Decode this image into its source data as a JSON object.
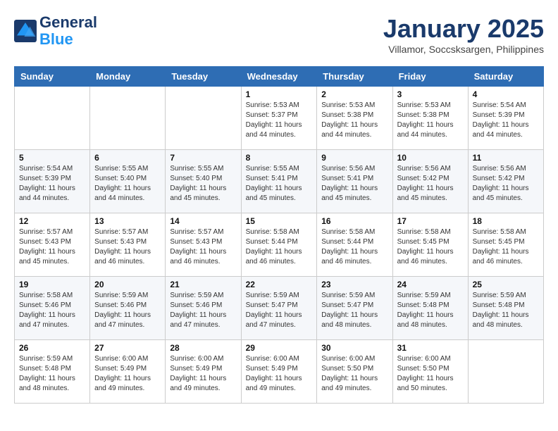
{
  "header": {
    "logo_line1": "General",
    "logo_line2": "Blue",
    "month_title": "January 2025",
    "location": "Villamor, Soccsksargen, Philippines"
  },
  "days_of_week": [
    "Sunday",
    "Monday",
    "Tuesday",
    "Wednesday",
    "Thursday",
    "Friday",
    "Saturday"
  ],
  "weeks": [
    [
      {
        "day": "",
        "info": ""
      },
      {
        "day": "",
        "info": ""
      },
      {
        "day": "",
        "info": ""
      },
      {
        "day": "1",
        "info": "Sunrise: 5:53 AM\nSunset: 5:37 PM\nDaylight: 11 hours and 44 minutes."
      },
      {
        "day": "2",
        "info": "Sunrise: 5:53 AM\nSunset: 5:38 PM\nDaylight: 11 hours and 44 minutes."
      },
      {
        "day": "3",
        "info": "Sunrise: 5:53 AM\nSunset: 5:38 PM\nDaylight: 11 hours and 44 minutes."
      },
      {
        "day": "4",
        "info": "Sunrise: 5:54 AM\nSunset: 5:39 PM\nDaylight: 11 hours and 44 minutes."
      }
    ],
    [
      {
        "day": "5",
        "info": "Sunrise: 5:54 AM\nSunset: 5:39 PM\nDaylight: 11 hours and 44 minutes."
      },
      {
        "day": "6",
        "info": "Sunrise: 5:55 AM\nSunset: 5:40 PM\nDaylight: 11 hours and 44 minutes."
      },
      {
        "day": "7",
        "info": "Sunrise: 5:55 AM\nSunset: 5:40 PM\nDaylight: 11 hours and 45 minutes."
      },
      {
        "day": "8",
        "info": "Sunrise: 5:55 AM\nSunset: 5:41 PM\nDaylight: 11 hours and 45 minutes."
      },
      {
        "day": "9",
        "info": "Sunrise: 5:56 AM\nSunset: 5:41 PM\nDaylight: 11 hours and 45 minutes."
      },
      {
        "day": "10",
        "info": "Sunrise: 5:56 AM\nSunset: 5:42 PM\nDaylight: 11 hours and 45 minutes."
      },
      {
        "day": "11",
        "info": "Sunrise: 5:56 AM\nSunset: 5:42 PM\nDaylight: 11 hours and 45 minutes."
      }
    ],
    [
      {
        "day": "12",
        "info": "Sunrise: 5:57 AM\nSunset: 5:43 PM\nDaylight: 11 hours and 45 minutes."
      },
      {
        "day": "13",
        "info": "Sunrise: 5:57 AM\nSunset: 5:43 PM\nDaylight: 11 hours and 46 minutes."
      },
      {
        "day": "14",
        "info": "Sunrise: 5:57 AM\nSunset: 5:43 PM\nDaylight: 11 hours and 46 minutes."
      },
      {
        "day": "15",
        "info": "Sunrise: 5:58 AM\nSunset: 5:44 PM\nDaylight: 11 hours and 46 minutes."
      },
      {
        "day": "16",
        "info": "Sunrise: 5:58 AM\nSunset: 5:44 PM\nDaylight: 11 hours and 46 minutes."
      },
      {
        "day": "17",
        "info": "Sunrise: 5:58 AM\nSunset: 5:45 PM\nDaylight: 11 hours and 46 minutes."
      },
      {
        "day": "18",
        "info": "Sunrise: 5:58 AM\nSunset: 5:45 PM\nDaylight: 11 hours and 46 minutes."
      }
    ],
    [
      {
        "day": "19",
        "info": "Sunrise: 5:58 AM\nSunset: 5:46 PM\nDaylight: 11 hours and 47 minutes."
      },
      {
        "day": "20",
        "info": "Sunrise: 5:59 AM\nSunset: 5:46 PM\nDaylight: 11 hours and 47 minutes."
      },
      {
        "day": "21",
        "info": "Sunrise: 5:59 AM\nSunset: 5:46 PM\nDaylight: 11 hours and 47 minutes."
      },
      {
        "day": "22",
        "info": "Sunrise: 5:59 AM\nSunset: 5:47 PM\nDaylight: 11 hours and 47 minutes."
      },
      {
        "day": "23",
        "info": "Sunrise: 5:59 AM\nSunset: 5:47 PM\nDaylight: 11 hours and 48 minutes."
      },
      {
        "day": "24",
        "info": "Sunrise: 5:59 AM\nSunset: 5:48 PM\nDaylight: 11 hours and 48 minutes."
      },
      {
        "day": "25",
        "info": "Sunrise: 5:59 AM\nSunset: 5:48 PM\nDaylight: 11 hours and 48 minutes."
      }
    ],
    [
      {
        "day": "26",
        "info": "Sunrise: 5:59 AM\nSunset: 5:48 PM\nDaylight: 11 hours and 48 minutes."
      },
      {
        "day": "27",
        "info": "Sunrise: 6:00 AM\nSunset: 5:49 PM\nDaylight: 11 hours and 49 minutes."
      },
      {
        "day": "28",
        "info": "Sunrise: 6:00 AM\nSunset: 5:49 PM\nDaylight: 11 hours and 49 minutes."
      },
      {
        "day": "29",
        "info": "Sunrise: 6:00 AM\nSunset: 5:49 PM\nDaylight: 11 hours and 49 minutes."
      },
      {
        "day": "30",
        "info": "Sunrise: 6:00 AM\nSunset: 5:50 PM\nDaylight: 11 hours and 49 minutes."
      },
      {
        "day": "31",
        "info": "Sunrise: 6:00 AM\nSunset: 5:50 PM\nDaylight: 11 hours and 50 minutes."
      },
      {
        "day": "",
        "info": ""
      }
    ]
  ]
}
